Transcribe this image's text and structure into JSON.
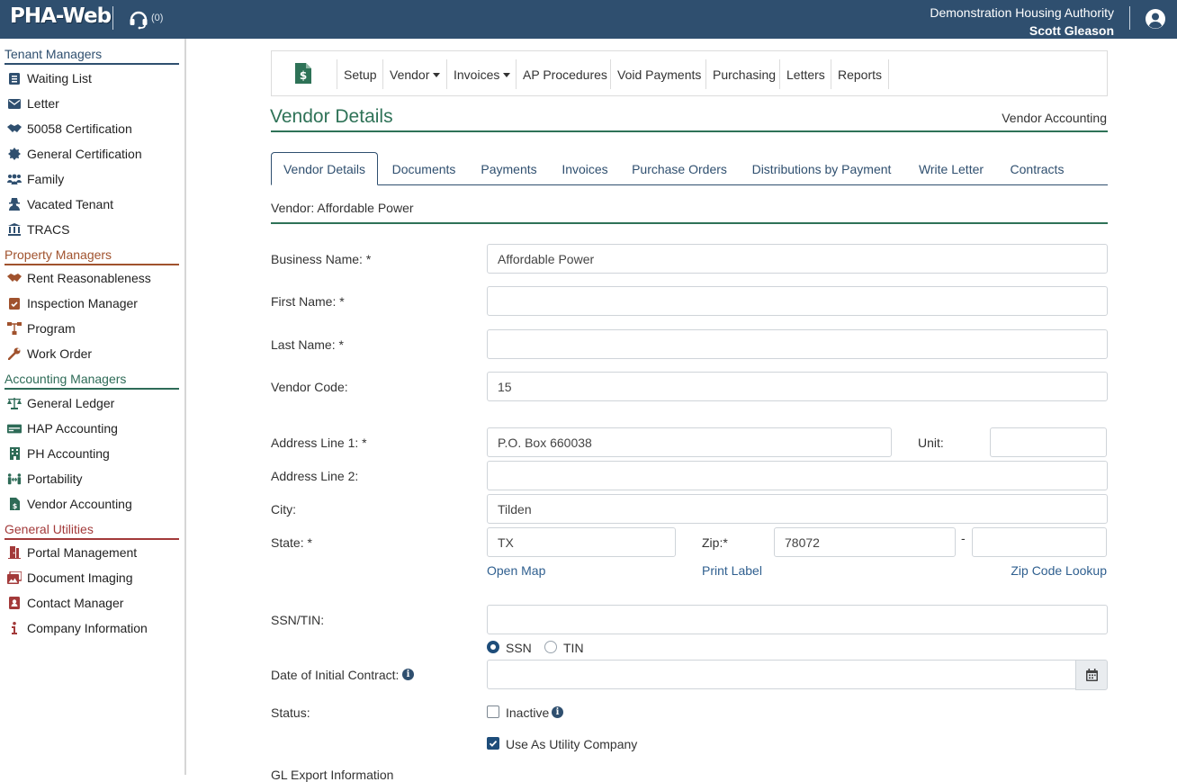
{
  "header": {
    "logo": "PHA-Web",
    "support_count": "(0)",
    "org_name": "Demonstration Housing Authority",
    "user_name": "Scott Gleason"
  },
  "sidebar": {
    "sections": [
      {
        "title": "Tenant Managers",
        "color": "#2f4f6f"
      },
      {
        "title": "Property Managers",
        "color": "#a0522d"
      },
      {
        "title": "Accounting Managers",
        "color": "#2e6b57"
      },
      {
        "title": "General Utilities",
        "color": "#a33a3a"
      }
    ],
    "tenant": [
      "Waiting List",
      "Letter",
      "50058 Certification",
      "General Certification",
      "Family",
      "Vacated Tenant",
      "TRACS"
    ],
    "property": [
      "Rent Reasonableness",
      "Inspection Manager",
      "Program",
      "Work Order"
    ],
    "accounting": [
      "General Ledger",
      "HAP Accounting",
      "PH Accounting",
      "Portability",
      "Vendor Accounting"
    ],
    "utilities": [
      "Portal Management",
      "Document Imaging",
      "Contact Manager",
      "Company Information"
    ]
  },
  "toolbar": {
    "setup": "Setup",
    "vendor": "Vendor",
    "invoices": "Invoices",
    "ap_procedures": "AP Procedures",
    "void_payments": "Void Payments",
    "purchasing": "Purchasing",
    "letters": "Letters",
    "reports": "Reports"
  },
  "page": {
    "title": "Vendor Details",
    "subtitle": "Vendor Accounting",
    "vendor_label": "Vendor: Affordable Power"
  },
  "tabs": [
    "Vendor Details",
    "Documents",
    "Payments",
    "Invoices",
    "Purchase Orders",
    "Distributions by Payment",
    "Write Letter",
    "Contracts"
  ],
  "form": {
    "business_name_label": "Business Name: *",
    "business_name": "Affordable Power",
    "first_name_label": "First Name: *",
    "first_name": "",
    "last_name_label": "Last Name: *",
    "last_name": "",
    "vendor_code_label": "Vendor Code:",
    "vendor_code": "15",
    "address1_label": "Address Line 1: *",
    "address1": "P.O. Box 660038",
    "unit_label": "Unit:",
    "unit": "",
    "address2_label": "Address Line 2:",
    "address2": "",
    "city_label": "City:",
    "city": "Tilden",
    "state_label": "State: *",
    "state": "TX",
    "zip_label": "Zip:*",
    "zip": "78072",
    "zip_dash": "-",
    "zip_ext": "",
    "open_map": "Open Map",
    "print_label": "Print Label",
    "zip_lookup": "Zip Code Lookup",
    "ssn_label": "SSN/TIN:",
    "ssn": "",
    "ssn_option": "SSN",
    "tin_option": "TIN",
    "ssn_selected": "SSN",
    "contract_date_label": "Date of Initial Contract:",
    "contract_date": "",
    "status_label": "Status:",
    "inactive_label": "Inactive",
    "inactive_checked": false,
    "utility_label": "Use As Utility Company",
    "utility_checked": true,
    "gl_export_label": "GL Export Information"
  },
  "colors": {
    "header_bg": "#2f4f6f",
    "accent_green": "#2e7257",
    "link_blue": "#2f5f8f"
  }
}
